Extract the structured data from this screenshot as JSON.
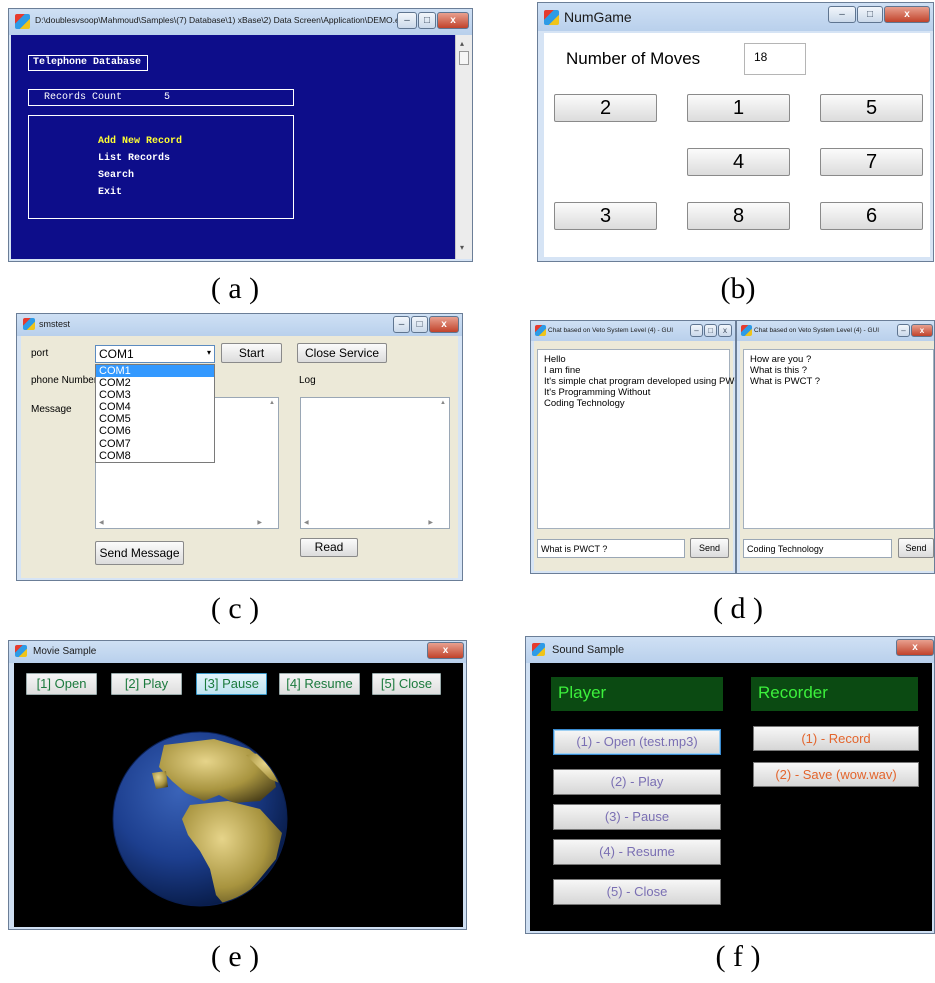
{
  "panel_a": {
    "title": "D:\\doublesvsoop\\Mahmoud\\Samples\\(7) Database\\1) xBase\\2) Data Screen\\Application\\DEMO.exe",
    "header": "Telephone Database",
    "count_label": "Records Count",
    "count_value": "5",
    "menu": [
      "Add New Record",
      "List Records",
      "Search",
      "Exit"
    ],
    "menu_colors": {
      "highlight": "#ffff33",
      "normal": "#ffffff"
    },
    "caption": "( a )"
  },
  "panel_b": {
    "title": "NumGame",
    "moves_label": "Number of Moves",
    "moves_value": "18",
    "tiles": [
      "2",
      "1",
      "5",
      "4",
      "7",
      "3",
      "8",
      "6"
    ],
    "caption": "(b)"
  },
  "panel_c": {
    "title": "smstest",
    "port_label": "port",
    "phone_label": "phone Number",
    "message_label": "Message",
    "selected_port": "COM1",
    "port_options": [
      "COM1",
      "COM2",
      "COM3",
      "COM4",
      "COM5",
      "COM6",
      "COM7",
      "COM8"
    ],
    "start_label": "Start",
    "close_service_label": "Close Service",
    "log_label": "Log",
    "send_label": "Send Message",
    "read_label": "Read",
    "caption": "( c )"
  },
  "panel_d": {
    "left": {
      "title": "Chat based on Veto System Level (4) - GUI",
      "lines": [
        "Hello",
        "I am fine",
        "It's simple chat program developed using PWCT",
        "It's Programming Without",
        "Coding Technology"
      ],
      "input": "What is PWCT ?",
      "send_label": "Send"
    },
    "right": {
      "title": "Chat based on Veto System Level (4) - GUI",
      "lines": [
        "How are you ?",
        "What is this ?",
        "What is PWCT ?"
      ],
      "input": "Coding Technology",
      "send_label": "Send"
    },
    "caption": "( d )"
  },
  "panel_e": {
    "title": "Movie Sample",
    "buttons": [
      "[1] Open",
      "[2] Play",
      "[3] Pause",
      "[4] Resume",
      "[5] Close"
    ],
    "selected_button": "[3] Pause",
    "caption": "( e )"
  },
  "panel_f": {
    "title": "Sound Sample",
    "player_label": "Player",
    "recorder_label": "Recorder",
    "player_buttons": [
      "(1) - Open (test.mp3)",
      "(2) - Play",
      "(3) - Pause",
      "(4) - Resume",
      "(5) - Close"
    ],
    "recorder_buttons": [
      "(1) - Record",
      "(2) - Save (wow.wav)"
    ],
    "colors": {
      "player": "#7a6fb3",
      "recorder": "#e3652d",
      "header_text": "#3cf03c"
    },
    "caption": "( f )"
  }
}
